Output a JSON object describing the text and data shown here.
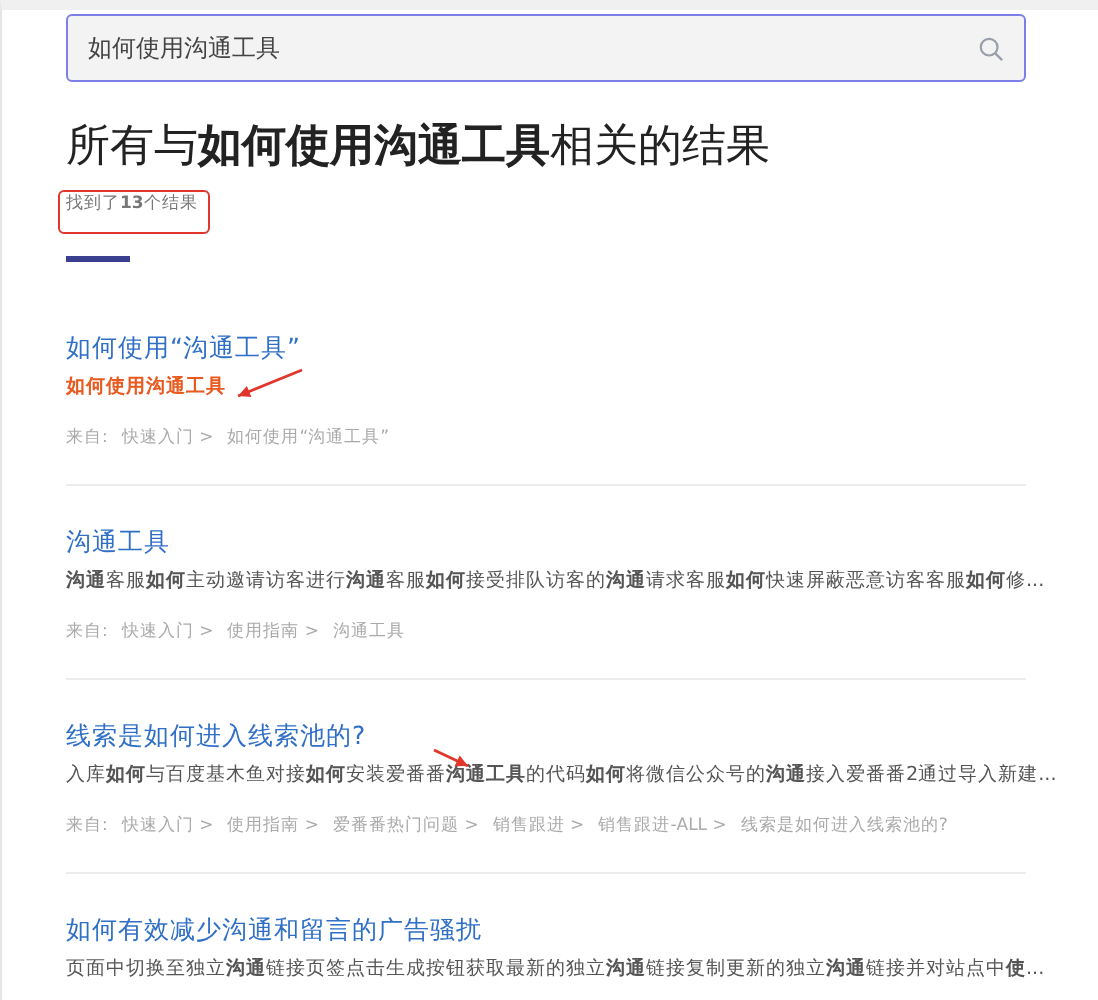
{
  "search": {
    "value": "如何使用沟通工具"
  },
  "heading": "所有与**如何使用沟通工具**相关的结果",
  "result_count": "找到了**13**个结果",
  "results": [
    {
      "title": "如何使用“沟通工具”",
      "snippet": "如何使用沟通工具",
      "snippet_highlighted": true,
      "source_label": "来自:",
      "breadcrumbs": [
        "快速入门 >",
        "如何使用“沟通工具”"
      ]
    },
    {
      "title": "沟通工具",
      "snippet": "**沟通**客服**如何**主动邀请访客进行**沟通**客服**如何**接受排队访客的**沟通**请求客服**如何**快速屏蔽恶意访客客服**如何**修...",
      "snippet_highlighted": false,
      "source_label": "来自:",
      "breadcrumbs": [
        "快速入门 >",
        "使用指南 >",
        "沟通工具"
      ]
    },
    {
      "title": "线索是如何进入线索池的?",
      "snippet": "入库**如何**与百度基木鱼对接**如何**安装爱番番**沟通工具**的代码**如何**将微信公众号的**沟通**接入爱番番2通过导入新建...",
      "snippet_highlighted": false,
      "source_label": "来自:",
      "breadcrumbs": [
        "快速入门 >",
        "使用指南 >",
        "爱番番热门问题 >",
        "销售跟进 >",
        "销售跟进-ALL >",
        "线索是如何进入线索池的?"
      ]
    },
    {
      "title": "如何有效减少沟通和留言的广告骚扰",
      "snippet": "页面中切换至独立**沟通**链接页签点击生成按钮获取最新的独立**沟通**链接复制更新的独立**沟通**链接并对站点中**使**...",
      "snippet_highlighted": false
    }
  ],
  "annotations": [
    {
      "kind": "box"
    },
    {
      "kind": "arrow"
    },
    {
      "kind": "arrow"
    }
  ]
}
